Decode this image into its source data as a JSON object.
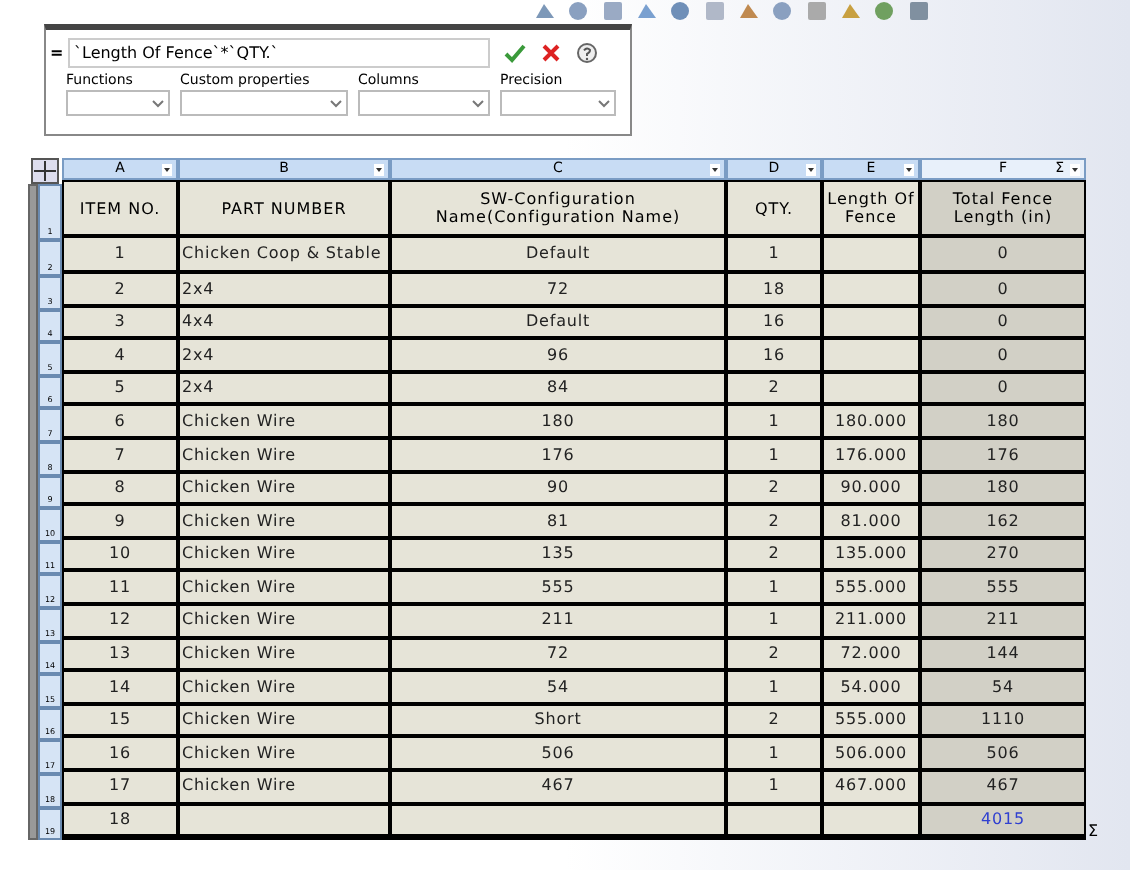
{
  "formula_bar": {
    "prefix": "=",
    "value": "`Length Of Fence`*`QTY.`",
    "dropdowns": [
      {
        "label": "Functions"
      },
      {
        "label": "Custom properties"
      },
      {
        "label": "Columns"
      },
      {
        "label": "Precision"
      }
    ]
  },
  "table": {
    "columns": [
      {
        "letter": "A",
        "header": "ITEM NO.",
        "selected": false
      },
      {
        "letter": "B",
        "header": "PART NUMBER",
        "selected": false
      },
      {
        "letter": "C",
        "header": "SW-Configuration Name(Configuration Name)",
        "selected": false
      },
      {
        "letter": "D",
        "header": "QTY.",
        "selected": false
      },
      {
        "letter": "E",
        "header": "Length Of Fence",
        "selected": false
      },
      {
        "letter": "F",
        "header": "Total Fence Length (in)",
        "selected": true,
        "sum_symbol": "Σ"
      }
    ],
    "header_row_number": "1",
    "rows": [
      {
        "n": "2",
        "cells": [
          "1",
          "Chicken Coop & Stable",
          "Default",
          "1",
          "",
          "0"
        ],
        "total": false
      },
      {
        "n": "3",
        "cells": [
          "2",
          "2x4",
          "72",
          "18",
          "",
          "0"
        ],
        "total": false
      },
      {
        "n": "4",
        "cells": [
          "3",
          "4x4",
          "Default",
          "16",
          "",
          "0"
        ],
        "total": false
      },
      {
        "n": "5",
        "cells": [
          "4",
          "2x4",
          "96",
          "16",
          "",
          "0"
        ],
        "total": false
      },
      {
        "n": "6",
        "cells": [
          "5",
          "2x4",
          "84",
          "2",
          "",
          "0"
        ],
        "total": false
      },
      {
        "n": "7",
        "cells": [
          "6",
          "Chicken Wire",
          "180",
          "1",
          "180.000",
          "180"
        ],
        "total": false
      },
      {
        "n": "8",
        "cells": [
          "7",
          "Chicken Wire",
          "176",
          "1",
          "176.000",
          "176"
        ],
        "total": false
      },
      {
        "n": "9",
        "cells": [
          "8",
          "Chicken Wire",
          "90",
          "2",
          "90.000",
          "180"
        ],
        "total": false
      },
      {
        "n": "10",
        "cells": [
          "9",
          "Chicken Wire",
          "81",
          "2",
          "81.000",
          "162"
        ],
        "total": false
      },
      {
        "n": "11",
        "cells": [
          "10",
          "Chicken Wire",
          "135",
          "2",
          "135.000",
          "270"
        ],
        "total": false
      },
      {
        "n": "12",
        "cells": [
          "11",
          "Chicken Wire",
          "555",
          "1",
          "555.000",
          "555"
        ],
        "total": false
      },
      {
        "n": "13",
        "cells": [
          "12",
          "Chicken Wire",
          "211",
          "1",
          "211.000",
          "211"
        ],
        "total": false
      },
      {
        "n": "14",
        "cells": [
          "13",
          "Chicken Wire",
          "72",
          "2",
          "72.000",
          "144"
        ],
        "total": false
      },
      {
        "n": "15",
        "cells": [
          "14",
          "Chicken Wire",
          "54",
          "1",
          "54.000",
          "54"
        ],
        "total": false
      },
      {
        "n": "16",
        "cells": [
          "15",
          "Chicken Wire",
          "Short",
          "2",
          "555.000",
          "1110"
        ],
        "total": false
      },
      {
        "n": "17",
        "cells": [
          "16",
          "Chicken Wire",
          "506",
          "1",
          "506.000",
          "506"
        ],
        "total": false
      },
      {
        "n": "18",
        "cells": [
          "17",
          "Chicken Wire",
          "467",
          "1",
          "467.000",
          "467"
        ],
        "total": false
      },
      {
        "n": "19",
        "cells": [
          "18",
          "",
          "",
          "",
          "",
          "4015"
        ],
        "total": true
      }
    ],
    "corner_sum_symbol": "Σ"
  }
}
